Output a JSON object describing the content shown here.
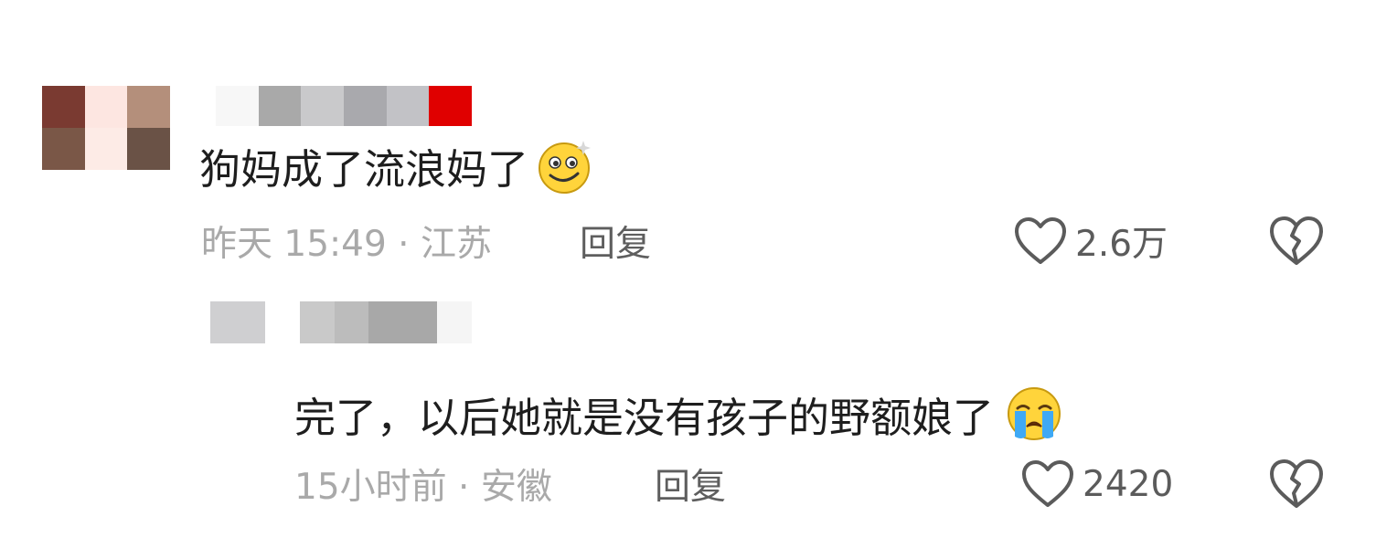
{
  "comments": [
    {
      "text": "狗妈成了流浪妈了",
      "emoji": "dizzy-smile-emoji",
      "meta": "昨天 15:49 · 江苏",
      "reply_label": "回复",
      "likes": "2.6万",
      "avatar_pixels": [
        "#7a3a31",
        "#fde6e1",
        "#b48f7b",
        "#7a5747",
        "#fdebe6",
        "#6a5246"
      ],
      "username_pixels": [
        "#f7f7f7",
        "#a9a9a9",
        "#c9c9cb",
        "#a9a9ad",
        "#c2c2c6",
        "#e00000"
      ]
    },
    {
      "text": "完了，以后她就是没有孩子的野额娘了",
      "emoji": "loudly-crying-emoji",
      "meta": "15小时前 · 安徽",
      "reply_label": "回复",
      "likes": "2420",
      "avatar_pixels": [
        "#cfcfd1"
      ],
      "username_pixels": [
        "#c9c9c9",
        "#bcbcbc",
        "#a8a8a8",
        "#f5f5f5"
      ]
    }
  ],
  "icons": {
    "like": "heart-outline-icon",
    "dislike": "broken-heart-icon"
  },
  "colors": {
    "text": "#1e1e1e",
    "meta": "#a9a9a9",
    "action": "#5b5b5b",
    "background": "#ffffff"
  }
}
